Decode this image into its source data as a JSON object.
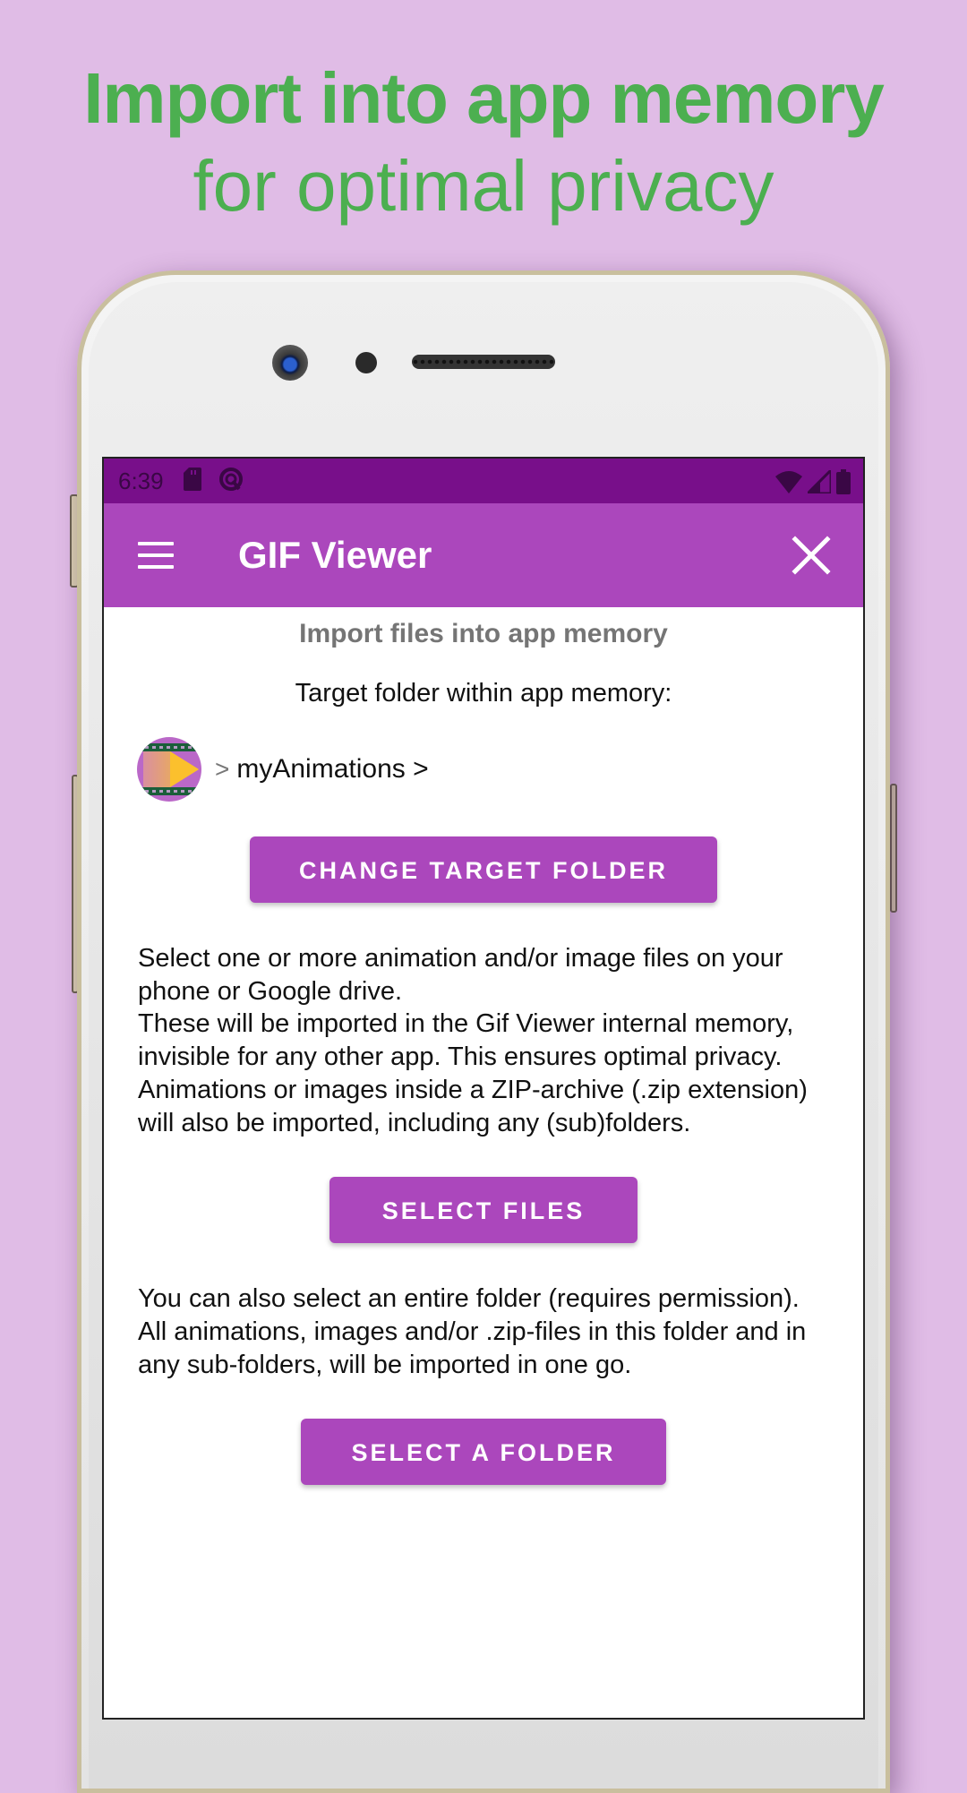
{
  "promo": {
    "headline_bold": "Import into app memory",
    "headline_regular": "for optimal privacy",
    "text_color": "#4caf50",
    "background_color": "#e0bce6"
  },
  "statusbar": {
    "time": "6:39",
    "left_icons": [
      "sd-card-icon",
      "data-saver-icon"
    ],
    "right_icons": [
      "wifi-icon",
      "cell-signal-icon",
      "battery-icon"
    ]
  },
  "appbar": {
    "title": "GIF Viewer",
    "menu_icon": "hamburger-menu-icon",
    "close_icon": "close-icon",
    "color": "#ab47bc",
    "statusbar_color": "#780f8a"
  },
  "content": {
    "section_title": "Import files into app memory",
    "target_label": "Target folder within app memory:",
    "breadcrumb": {
      "root_icon": "gif-viewer-app-icon",
      "separator": ">",
      "folder": "myAnimations >"
    },
    "change_target_button": "CHANGE TARGET FOLDER",
    "files_description": [
      "Select one or more animation and/or image files on your phone or Google drive.",
      "These will be imported in the Gif Viewer internal memory, invisible for any other app. This ensures optimal privacy.",
      "Animations or images inside a ZIP-archive (.zip extension) will also be imported, including any (sub)folders."
    ],
    "select_files_button": "SELECT FILES",
    "folder_description": [
      "You can also select an entire folder (requires permission).",
      "All animations, images and/or .zip-files in this folder and in any sub-folders, will be imported in one go."
    ],
    "select_folder_button": "SELECT A FOLDER"
  }
}
